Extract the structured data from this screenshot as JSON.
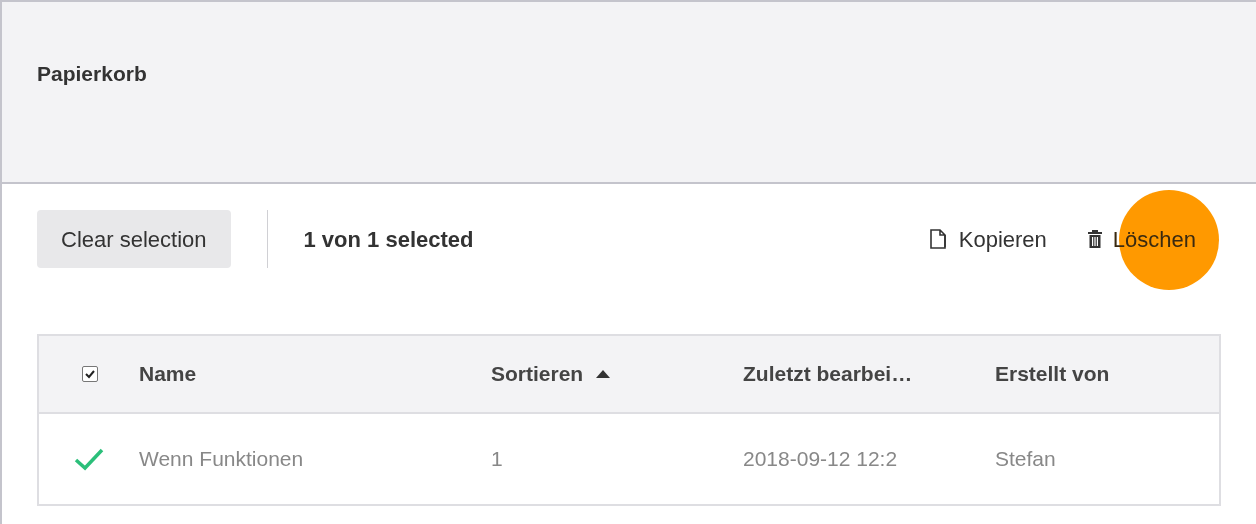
{
  "header": {
    "title": "Papierkorb"
  },
  "toolbar": {
    "clear_button": "Clear selection",
    "selection_count": "1 von 1 selected",
    "actions": [
      {
        "kind": "copy",
        "label": "Kopieren",
        "highlighted": false
      },
      {
        "kind": "delete",
        "label": "Löschen",
        "highlighted": true
      }
    ]
  },
  "table": {
    "header_checked": true,
    "columns": [
      {
        "label": "Name",
        "sorted": false
      },
      {
        "label": "Sortieren",
        "sorted": true
      },
      {
        "label": "Zuletzt bearbei…",
        "sorted": false
      },
      {
        "label": "Erstellt von",
        "sorted": false
      }
    ],
    "rows": [
      {
        "selected": true,
        "cells": [
          "Wenn Funktionen",
          "1",
          "2018-09-12 12:2",
          "Stefan"
        ]
      }
    ]
  }
}
